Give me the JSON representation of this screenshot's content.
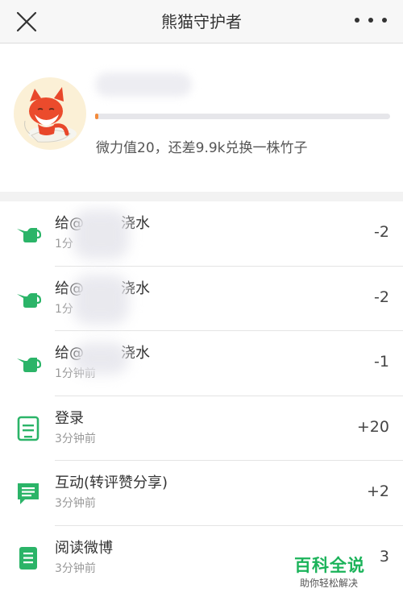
{
  "header": {
    "title": "熊猫守护者",
    "close_icon": "close-icon",
    "more_icon": "more-icon"
  },
  "profile": {
    "status_text": "微力值20，还差9.9k兑换一株竹子",
    "progress_fraction": 0.002,
    "progress_color": "#f38b3c",
    "avatar_icon": "fox-avatar-icon"
  },
  "records": [
    {
      "icon": "watering-can-icon",
      "label": "给@",
      "label_tail": "浇水",
      "time": "1分",
      "points": "-2"
    },
    {
      "icon": "watering-can-icon",
      "label": "给@",
      "label_tail": "浇水",
      "time": "1分",
      "points": "-2"
    },
    {
      "icon": "watering-can-icon",
      "label": "给@",
      "label_tail": "浇水",
      "time": "1分钟前",
      "points": "-1"
    },
    {
      "icon": "login-icon",
      "label": "登录",
      "label_tail": "",
      "time": "3分钟前",
      "points": "+20"
    },
    {
      "icon": "chat-icon",
      "label": "互动(转评赞分享)",
      "label_tail": "",
      "time": "3分钟前",
      "points": "+2"
    },
    {
      "icon": "document-icon",
      "label": "阅读微博",
      "label_tail": "",
      "time": "3分钟前",
      "points": "3"
    }
  ],
  "watermark": {
    "main": "百科全说",
    "sub": "助你轻松解决"
  },
  "colors": {
    "accent_green": "#2bb468",
    "nav_bg": "#f7f7f7"
  }
}
